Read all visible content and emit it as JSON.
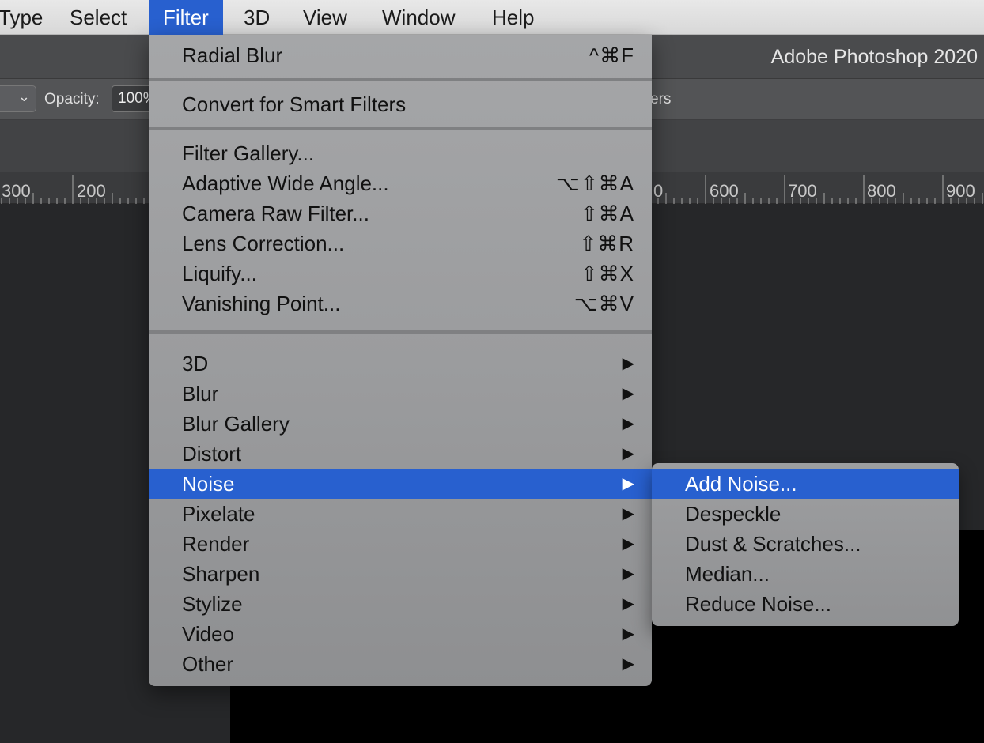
{
  "menubar": {
    "items": [
      "Type",
      "Select",
      "Filter",
      "3D",
      "View",
      "Window",
      "Help"
    ],
    "active": "Filter"
  },
  "titlebar": {
    "title": "Adobe Photoshop 2020"
  },
  "options": {
    "opacity_label": "Opacity:",
    "opacity_value": "100%",
    "layers_text": "ers"
  },
  "ruler": {
    "labels": [
      "300",
      "200",
      "0",
      "600",
      "700",
      "800",
      "900"
    ]
  },
  "filter_menu": {
    "groups": [
      [
        {
          "label": "Radial Blur",
          "shortcut": "^⌘F"
        }
      ],
      [
        {
          "label": "Convert for Smart Filters"
        }
      ],
      [
        {
          "label": "Filter Gallery..."
        },
        {
          "label": "Adaptive Wide Angle...",
          "shortcut": "⌥⇧⌘A"
        },
        {
          "label": "Camera Raw Filter...",
          "shortcut": "⇧⌘A"
        },
        {
          "label": "Lens Correction...",
          "shortcut": "⇧⌘R"
        },
        {
          "label": "Liquify...",
          "shortcut": "⇧⌘X"
        },
        {
          "label": "Vanishing Point...",
          "shortcut": "⌥⌘V"
        }
      ],
      [
        {
          "label": "3D",
          "submenu": true
        },
        {
          "label": "Blur",
          "submenu": true
        },
        {
          "label": "Blur Gallery",
          "submenu": true
        },
        {
          "label": "Distort",
          "submenu": true
        },
        {
          "label": "Noise",
          "submenu": true,
          "highlighted": true
        },
        {
          "label": "Pixelate",
          "submenu": true
        },
        {
          "label": "Render",
          "submenu": true
        },
        {
          "label": "Sharpen",
          "submenu": true
        },
        {
          "label": "Stylize",
          "submenu": true
        },
        {
          "label": "Video",
          "submenu": true
        },
        {
          "label": "Other",
          "submenu": true
        }
      ]
    ],
    "arrow_glyph": "▶"
  },
  "noise_submenu": {
    "items": [
      {
        "label": "Add Noise...",
        "highlighted": true
      },
      {
        "label": "Despeckle"
      },
      {
        "label": "Dust & Scratches..."
      },
      {
        "label": "Median..."
      },
      {
        "label": "Reduce Noise..."
      }
    ]
  },
  "colors": {
    "highlight": "#2860cf"
  }
}
